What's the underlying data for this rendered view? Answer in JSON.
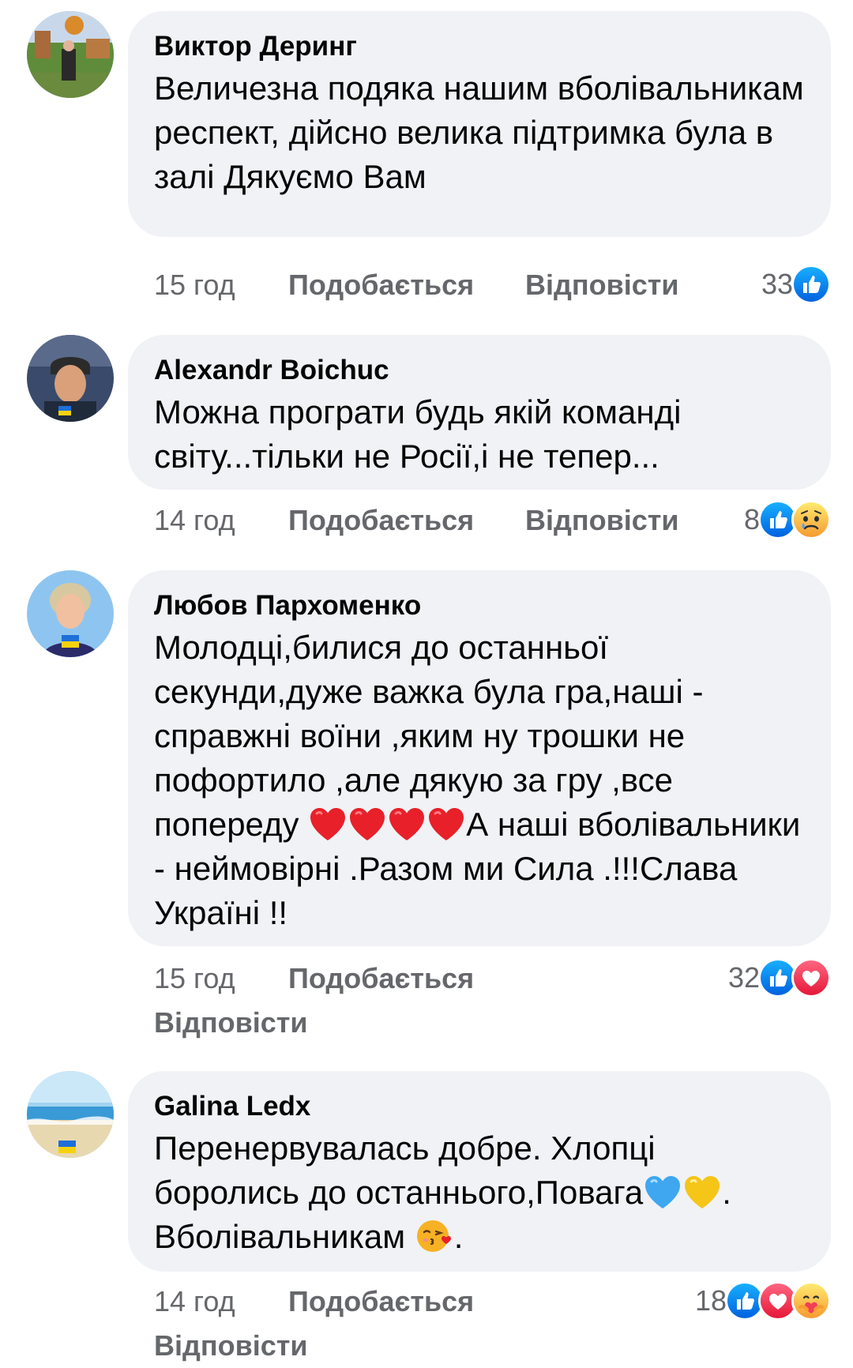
{
  "comments": [
    {
      "author": "Виктор Деринг",
      "text": "Величезна подяка нашим вболівальникам  респект, дійсно велика підтримка була в залі Дякуємо Вам",
      "time": "15 год",
      "like_label": "Подобається",
      "reply_label": "Відповісти",
      "reaction_count": "33",
      "reactions": [
        "like-icon"
      ]
    },
    {
      "author": "Alexandr Boichuc",
      "text": "Можна програти будь якій команді світу...тільки не Росії,і не тепер...",
      "time": "14 год",
      "like_label": "Подобається",
      "reply_label": "Відповісти",
      "reaction_count": "8",
      "reactions": [
        "like-icon",
        "sad-icon"
      ]
    },
    {
      "author": "Любов Пархоменко",
      "text_part1": "Молодці,билися до останньої секунди,дуже важка була гра,наші - справжні воїни ,яким ну трошки не пофортило ,але дякую за гру ,все попереду ",
      "text_part2": "А наші вболівальники - неймовірні .Разом ми Сила .!!!Слава Україні !!",
      "inline_emoji": [
        "red-heart-icon",
        "red-heart-icon",
        "red-heart-icon",
        "red-heart-icon"
      ],
      "time": "15 год",
      "like_label": "Подобається",
      "reply_label": "Відповісти",
      "reaction_count": "32",
      "reactions": [
        "like-icon",
        "love-icon"
      ]
    },
    {
      "author": "Galina Ledx",
      "text_part1": "Перенервувалась добре. Хлопці боролись до останнього,Повага",
      "text_part2": ". Вболівальникам ",
      "text_part3": ".",
      "inline_emoji": [
        "blue-heart-icon",
        "yellow-heart-icon",
        "kiss-face-icon"
      ],
      "time": "14 год",
      "like_label": "Подобається",
      "reply_label": "Відповісти",
      "reaction_count": "18",
      "reactions": [
        "like-icon",
        "love-icon",
        "care-icon"
      ]
    }
  ],
  "colors": {
    "bubble": "#f0f2f5",
    "meta_text": "#65676b",
    "like_blue": "#1877f2",
    "love_red": "#f33e58",
    "emoji_yellow": "#f7b125"
  }
}
